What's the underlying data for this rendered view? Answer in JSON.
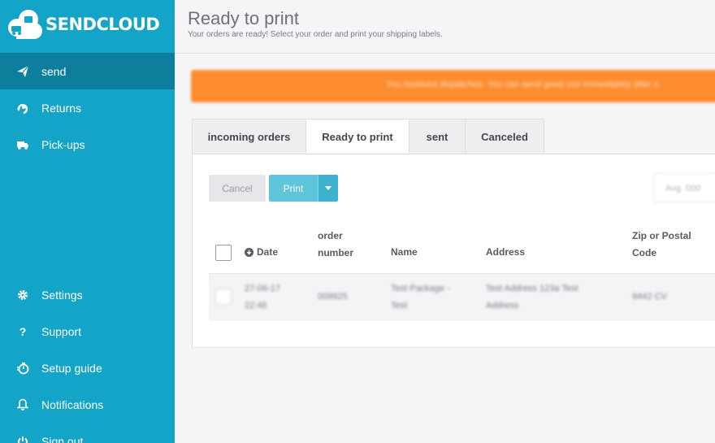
{
  "brand": {
    "name": "SENDCLOUD",
    "sidebar_color": "#14a4c7",
    "active_color": "#0d7f9c"
  },
  "sidebar": {
    "items": [
      {
        "label": "send",
        "icon": "paper-plane-icon"
      },
      {
        "label": "Returns",
        "icon": "returns-icon"
      },
      {
        "label": "Pick-ups",
        "icon": "truck-icon"
      },
      {
        "label": "Settings",
        "icon": "gear-icon"
      },
      {
        "label": "Support",
        "icon": "question-icon"
      },
      {
        "label": "Setup guide",
        "icon": "stopwatch-icon"
      },
      {
        "label": "Notifications",
        "icon": "bell-icon"
      },
      {
        "label": "Sign out",
        "icon": "power-icon"
      }
    ]
  },
  "header": {
    "title": "Ready to print",
    "subtitle": "Your orders are ready! Select your order and print your shipping labels."
  },
  "banner": {
    "text": "You received dispatches. You can send great use immediately after n",
    "color": "#fd8c2e"
  },
  "tabs": [
    {
      "label": "incoming orders",
      "active": false
    },
    {
      "label": "Ready to print",
      "active": true
    },
    {
      "label": "sent",
      "active": false
    },
    {
      "label": "Canceled",
      "active": false
    }
  ],
  "toolbar": {
    "cancel_label": "Cancel",
    "print_label": "Print",
    "search_placeholder": "Avg. 000"
  },
  "table": {
    "columns": {
      "date": "Date",
      "order_number_line1": "order",
      "order_number_line2": "number",
      "name": "Name",
      "address": "Address",
      "zip_line1": "Zip or Postal",
      "zip_line2": "Code"
    },
    "rows": [
      {
        "date_line1": "27-06-17",
        "date_line2": "22:46",
        "order_number": "009925",
        "name_line1": "Test Package -",
        "name_line2": "Test",
        "address_line1": "Test Address 123a Test",
        "address_line2": "Address",
        "zip": "9442 CV"
      }
    ]
  }
}
